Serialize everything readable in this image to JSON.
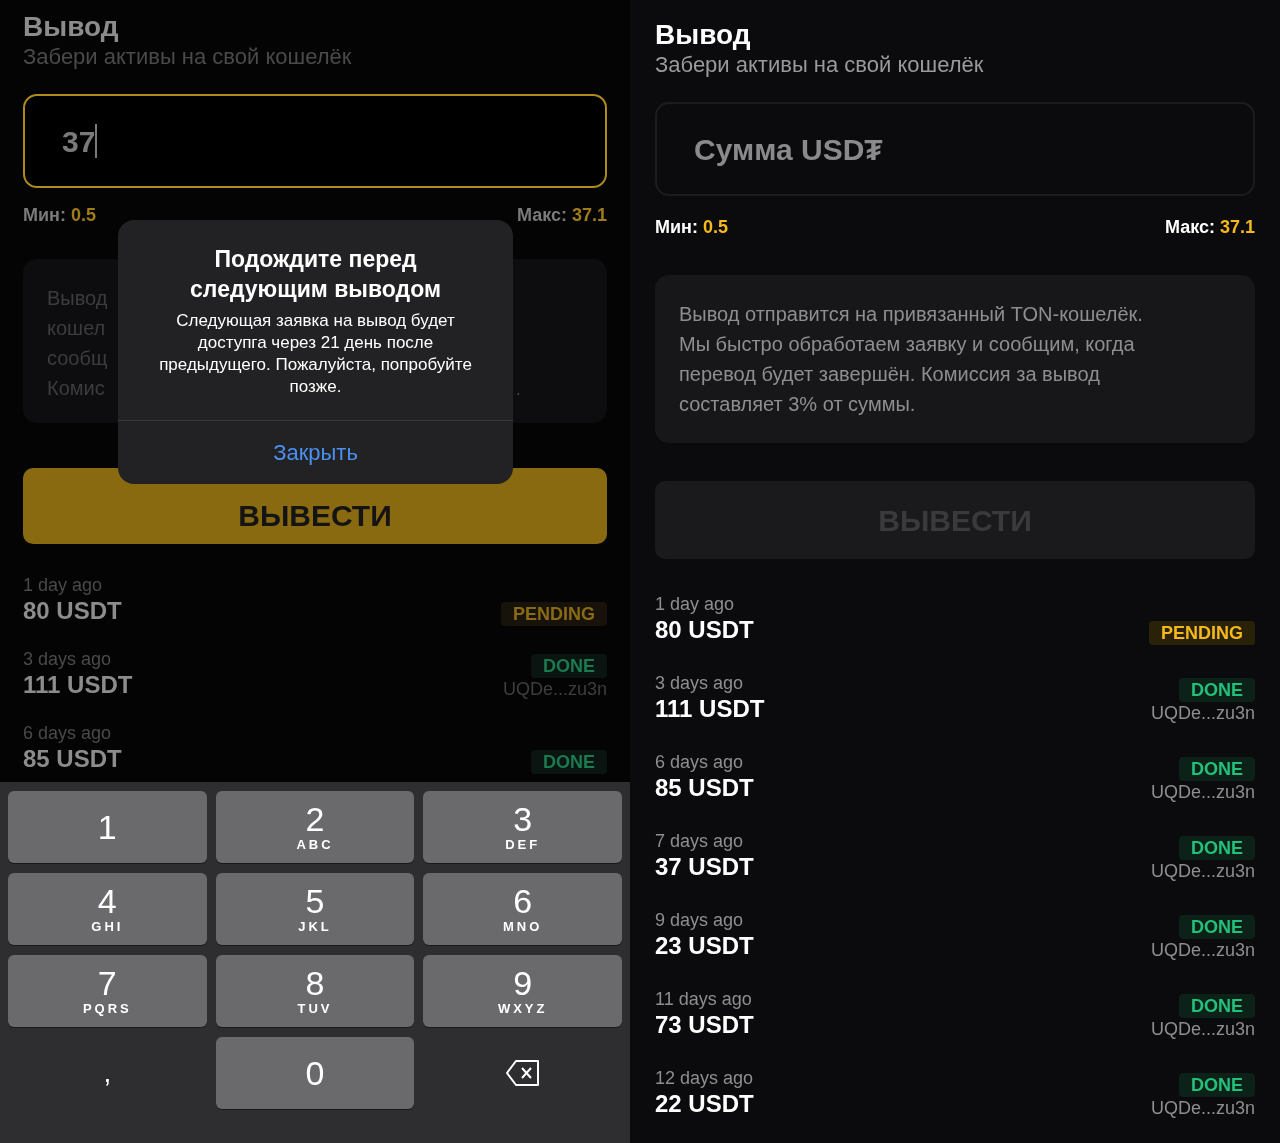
{
  "screens": [
    {
      "title": "Вывод",
      "subtitle": "Забери активы на свой кошелёк",
      "amount_field": {
        "value": "37",
        "focused": true
      },
      "min_label": "Мин:",
      "min_value": "0.5",
      "max_label": "Макс:",
      "max_value": "37.1",
      "info_card": {
        "lines": [
          "Вывод",
          "кошел",
          "сообщ",
          "Комис"
        ],
        "tail": "."
      },
      "button": {
        "label": "ВЫВЕСТИ",
        "disabled": false
      },
      "history": [
        {
          "date": "1 day ago",
          "amount": "80 USDT",
          "status": "PENDING",
          "kind": "pending"
        },
        {
          "date": "3 days ago",
          "amount": "111 USDT",
          "status": "DONE",
          "kind": "done",
          "address": "UQDe...zu3n"
        },
        {
          "date": "6 days ago",
          "amount": "85 USDT",
          "status": "DONE",
          "kind": "done"
        }
      ],
      "dialog": {
        "title": "Подождите перед следующим выводом",
        "message": "Следующая заявка на вывод будет доступга через 21 день после предыдущего. Пожалуйста, попробуйте позже.",
        "action": "Закрыть"
      },
      "keyboard": [
        {
          "kind": "digit",
          "digit": "1"
        },
        {
          "kind": "digit",
          "digit": "2",
          "letters": "ABC"
        },
        {
          "kind": "digit",
          "digit": "3",
          "letters": "DEF"
        },
        {
          "kind": "digit",
          "digit": "4",
          "letters": "GHI"
        },
        {
          "kind": "digit",
          "digit": "5",
          "letters": "JKL"
        },
        {
          "kind": "digit",
          "digit": "6",
          "letters": "MNO"
        },
        {
          "kind": "digit",
          "digit": "7",
          "letters": "PQRS"
        },
        {
          "kind": "digit",
          "digit": "8",
          "letters": "TUV"
        },
        {
          "kind": "digit",
          "digit": "9",
          "letters": "WXYZ"
        },
        {
          "kind": "plain",
          "digit": ","
        },
        {
          "kind": "digit",
          "digit": "0"
        },
        {
          "kind": "backspace"
        }
      ]
    },
    {
      "title": "Вывод",
      "subtitle": "Забери активы на свой кошелёк",
      "amount_field": {
        "placeholder": "Сумма USD₮",
        "focused": false
      },
      "min_label": "Мин:",
      "min_value": "0.5",
      "max_label": "Макс:",
      "max_value": "37.1",
      "info_card": {
        "text": "Вывод отправится на привязанный TON-кошелёк. Мы быстро обработаем заявку и сообщим, когда перевод будет завершён. Комиссия за вывод составляет 3% от суммы."
      },
      "button": {
        "label": "ВЫВЕСТИ",
        "disabled": true
      },
      "history": [
        {
          "date": "1 day ago",
          "amount": "80 USDT",
          "status": "PENDING",
          "kind": "pending"
        },
        {
          "date": "3 days ago",
          "amount": "111 USDT",
          "status": "DONE",
          "kind": "done",
          "address": "UQDe...zu3n"
        },
        {
          "date": "6 days ago",
          "amount": "85 USDT",
          "status": "DONE",
          "kind": "done",
          "address": "UQDe...zu3n"
        },
        {
          "date": "7 days ago",
          "amount": "37 USDT",
          "status": "DONE",
          "kind": "done",
          "address": "UQDe...zu3n"
        },
        {
          "date": "9 days ago",
          "amount": "23 USDT",
          "status": "DONE",
          "kind": "done",
          "address": "UQDe...zu3n"
        },
        {
          "date": "11 days ago",
          "amount": "73 USDT",
          "status": "DONE",
          "kind": "done",
          "address": "UQDe...zu3n"
        },
        {
          "date": "12 days ago",
          "amount": "22 USDT",
          "status": "DONE",
          "kind": "done",
          "address": "UQDe...zu3n"
        }
      ]
    }
  ]
}
